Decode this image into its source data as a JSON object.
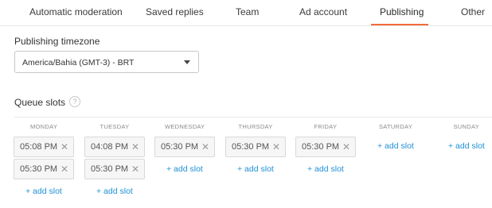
{
  "tabs": [
    {
      "label": "Automatic moderation",
      "active": false
    },
    {
      "label": "Saved replies",
      "active": false
    },
    {
      "label": "Team",
      "active": false
    },
    {
      "label": "Ad account",
      "active": false
    },
    {
      "label": "Publishing",
      "active": true
    },
    {
      "label": "Other",
      "active": false
    }
  ],
  "timezone": {
    "label": "Publishing timezone",
    "value": "America/Bahia (GMT-3) - BRT",
    "caret_icon": "caret-down-icon"
  },
  "queue": {
    "title": "Queue slots",
    "help_symbol": "?",
    "remove_symbol": "✕",
    "add_label": "+ add slot",
    "days": [
      {
        "name": "MONDAY",
        "slots": [
          "05:08 PM",
          "05:30 PM"
        ]
      },
      {
        "name": "TUESDAY",
        "slots": [
          "04:08 PM",
          "05:30 PM"
        ]
      },
      {
        "name": "WEDNESDAY",
        "slots": [
          "05:30 PM"
        ]
      },
      {
        "name": "THURSDAY",
        "slots": [
          "05:30 PM"
        ]
      },
      {
        "name": "FRIDAY",
        "slots": [
          "05:30 PM"
        ]
      },
      {
        "name": "SATURDAY",
        "slots": []
      },
      {
        "name": "SUNDAY",
        "slots": []
      }
    ]
  },
  "colors": {
    "accent": "#f26b3a",
    "link": "#1e90d6",
    "slot_bg": "#f6f6f6",
    "border": "#d9d9d9"
  }
}
